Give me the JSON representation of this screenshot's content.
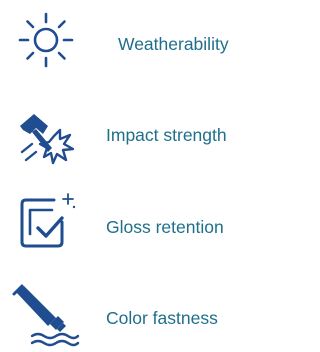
{
  "colors": {
    "icon": "#1f4d8f",
    "label": "#1f6f8b",
    "background": "#ffffff"
  },
  "features": [
    {
      "icon": "sun-icon",
      "label": "Weatherability"
    },
    {
      "icon": "hammer-impact-icon",
      "label": "Impact strength"
    },
    {
      "icon": "glossy-checkbox-icon",
      "label": "Gloss retention"
    },
    {
      "icon": "paint-tube-icon",
      "label": "Color fastness"
    }
  ]
}
